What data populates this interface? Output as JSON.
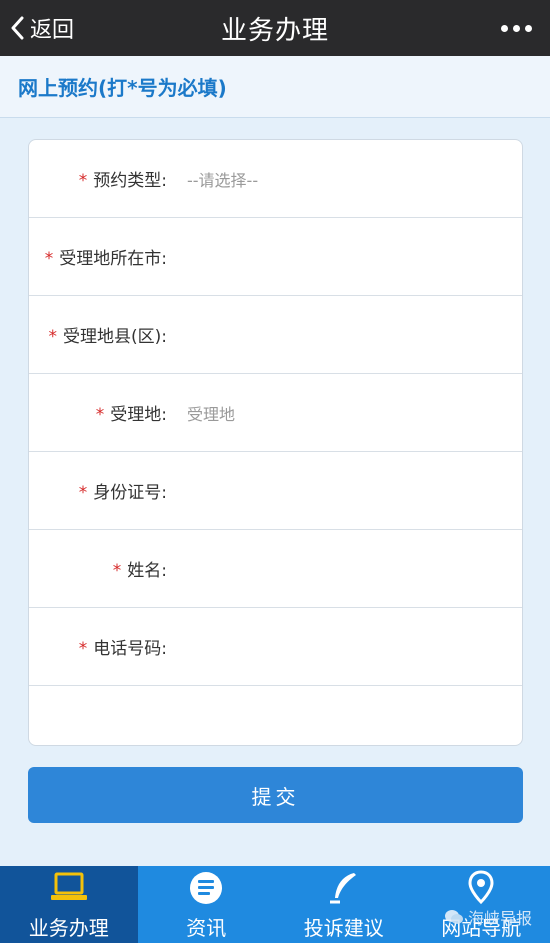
{
  "topbar": {
    "back_label": "返回",
    "title": "业务办理"
  },
  "section": {
    "title": "网上预约(打*号为必填)"
  },
  "form": {
    "required_mark": "*",
    "fields": [
      {
        "label": "预约类型:",
        "value": "--请选择--"
      },
      {
        "label": "受理地所在市:",
        "value": ""
      },
      {
        "label": "受理地县(区):",
        "value": ""
      },
      {
        "label": "受理地:",
        "value": "受理地"
      },
      {
        "label": "身份证号:",
        "value": ""
      },
      {
        "label": "姓名:",
        "value": ""
      },
      {
        "label": "电话号码:",
        "value": ""
      }
    ]
  },
  "submit_label": "提交",
  "tabbar": {
    "tabs": [
      {
        "label": "业务办理",
        "icon": "laptop-icon",
        "active": true
      },
      {
        "label": "资讯",
        "icon": "news-icon",
        "active": false
      },
      {
        "label": "投诉建议",
        "icon": "feather-pen-icon",
        "active": false
      },
      {
        "label": "网站导航",
        "icon": "location-pin-icon",
        "active": false
      }
    ]
  },
  "watermark": "海峡导报",
  "colors": {
    "accent": "#2e86d8",
    "tabbar": "#1f8ae0",
    "tab_active": "#11549a",
    "required": "#d62a2a",
    "section_title": "#1b79c9"
  }
}
